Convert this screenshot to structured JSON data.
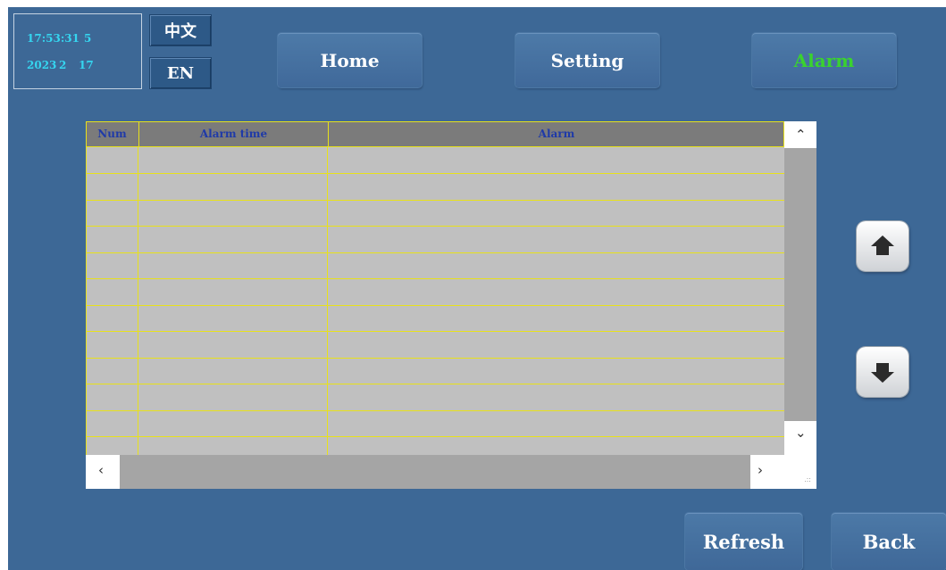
{
  "clock": {
    "time": "17:53:31",
    "weekday": "5",
    "year": "2023",
    "month": "2",
    "day": "17"
  },
  "language": {
    "chinese": "中文",
    "english": "EN"
  },
  "nav": {
    "home": "Home",
    "setting": "Setting",
    "alarm": "Alarm"
  },
  "table": {
    "columns": [
      "Num",
      "Alarm time",
      "Alarm"
    ],
    "row_count": 11
  },
  "actions": {
    "refresh": "Refresh",
    "back": "Back"
  },
  "icons": {
    "page_up": "arrow-up-icon",
    "page_down": "arrow-down-icon",
    "scroll_up": "chevron-up-icon",
    "scroll_down": "chevron-down-icon",
    "scroll_left": "chevron-left-icon",
    "scroll_right": "chevron-right-icon"
  },
  "colors": {
    "background": "#3d6896",
    "clock_text": "#35d6f0",
    "alarm_active": "#3ad22f",
    "grid_line": "#e8e11a",
    "header_text": "#1f3aa8",
    "grid_fill": "#c0c0c0"
  }
}
